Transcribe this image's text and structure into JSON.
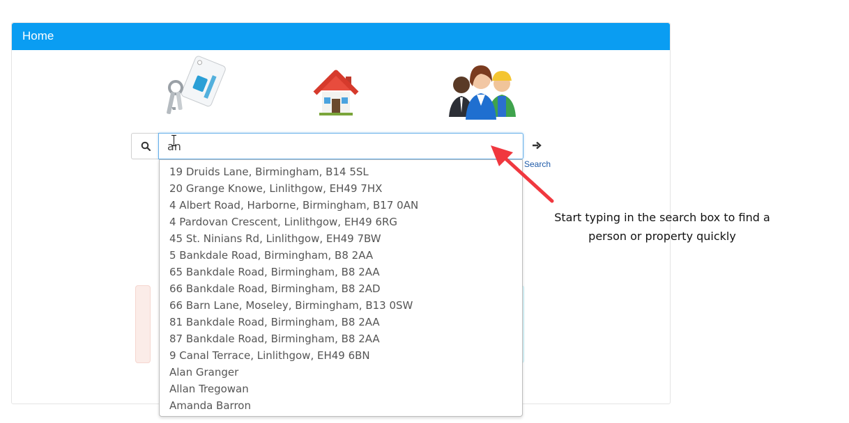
{
  "panel": {
    "title": "Home",
    "header_color": "#0a9df2"
  },
  "tiles": [
    {
      "icon": "keys-icon"
    },
    {
      "icon": "house-icon"
    },
    {
      "icon": "people-icon"
    }
  ],
  "search": {
    "value": "an",
    "icon": "search-icon",
    "go_icon": "arrow-right-icon",
    "go_label": "Search"
  },
  "suggestions": [
    "19 Druids Lane, Birmingham, B14 5SL",
    "20 Grange Knowe, Linlithgow, EH49 7HX",
    "4 Albert Road, Harborne, Birmingham, B17 0AN",
    "4 Pardovan Crescent, Linlithgow, EH49 6RG",
    "45 St. Ninians Rd, Linlithgow, EH49 7BW",
    "5 Bankdale Road, Birmingham, B8 2AA",
    "65 Bankdale Road, Birmingham, B8 2AA",
    "66 Bankdale Road, Birmingham, B8 2AD",
    "66 Barn Lane, Moseley, Birmingham, B13 0SW",
    "81 Bankdale Road, Birmingham, B8 2AA",
    "87 Bankdale Road, Birmingham, B8 2AA",
    "9 Canal Terrace, Linlithgow, EH49 6BN",
    "Alan Granger",
    "Allan Tregowan",
    "Amanda Barron"
  ],
  "annotation": {
    "line1": "Start typing in the search box to find a",
    "line2": "person or property quickly",
    "arrow_color": "#f0383f"
  }
}
